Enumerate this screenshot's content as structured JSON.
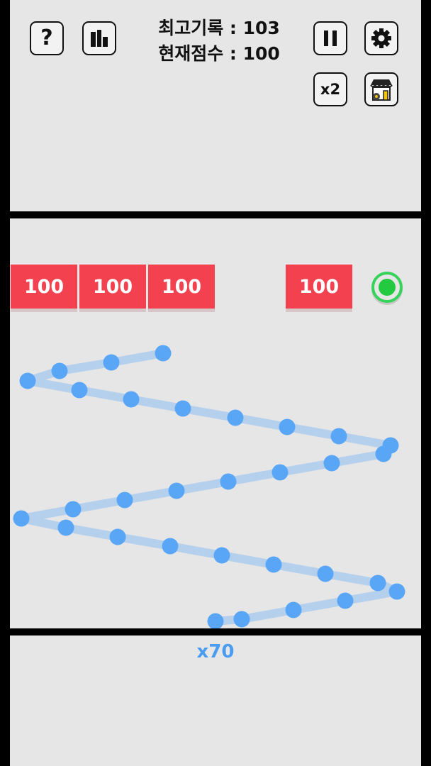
{
  "hud": {
    "best_label": "최고기록 : 103",
    "current_label": "현재점수 : 100",
    "help_glyph": "?",
    "speed_label": "x2",
    "icons": [
      "help-icon",
      "leaderboard-icon",
      "pause-icon",
      "settings-icon",
      "shop-icon"
    ]
  },
  "field": {
    "bricks": [
      {
        "label": "100"
      },
      {
        "label": "100"
      },
      {
        "label": "100"
      },
      {
        "label": "100"
      }
    ],
    "powerup": "extra-ball-ring"
  },
  "footer": {
    "ball_count": "x70"
  },
  "colors": {
    "brick": "#f4414f",
    "ball": "#5aa6f6",
    "powerup": "#23c93f",
    "panel": "#e6e6e6",
    "ball_count": "#4b9cf1"
  }
}
